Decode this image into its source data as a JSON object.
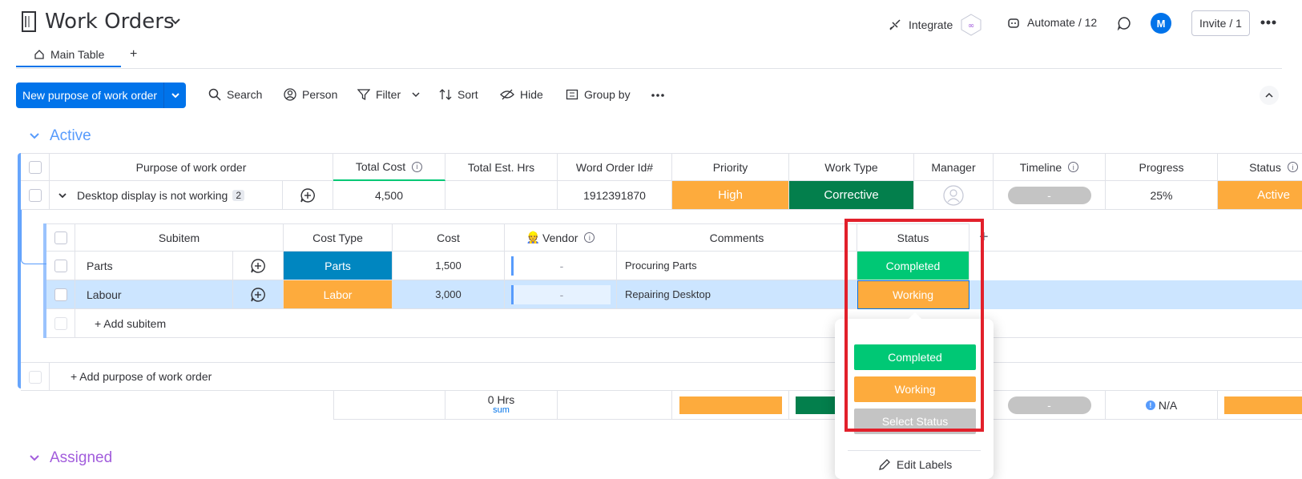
{
  "board": {
    "title": "Work Orders",
    "actions": {
      "integrate": "Integrate",
      "automate": "Automate / 12",
      "avatar_initial": "M",
      "invite": "Invite / 1"
    }
  },
  "tabs": [
    {
      "label": "Main Table"
    },
    {
      "label": "+"
    }
  ],
  "toolbar": {
    "new_item": "New purpose of work order",
    "search": "Search",
    "person": "Person",
    "filter": "Filter",
    "sort": "Sort",
    "hide": "Hide",
    "group_by": "Group by"
  },
  "groups": {
    "active": {
      "title": "Active",
      "color": "#579bfc"
    },
    "assigned": {
      "title": "Assigned",
      "color": "#a25ddc"
    }
  },
  "columns": {
    "purpose": "Purpose of work order",
    "total_cost": "Total Cost",
    "total_est_hrs": "Total Est. Hrs",
    "order_id": "Word Order Id#",
    "priority": "Priority",
    "work_type": "Work Type",
    "manager": "Manager",
    "timeline": "Timeline",
    "progress": "Progress",
    "status": "Status"
  },
  "row": {
    "name": "Desktop display is not working",
    "subitem_count": "2",
    "total_cost": "4,500",
    "order_id": "1912391870",
    "priority": "High",
    "work_type": "Corrective",
    "timeline": "-",
    "progress": "25%",
    "status": "Active"
  },
  "subitems": {
    "columns": {
      "subitem": "Subitem",
      "cost_type": "Cost Type",
      "cost": "Cost",
      "vendor": "Vendor",
      "comments": "Comments",
      "status": "Status",
      "add": "+"
    },
    "rows": [
      {
        "name": "Parts",
        "cost_type": "Parts",
        "cost": "1,500",
        "vendor": "-",
        "comments": "Procuring Parts",
        "status": "Completed"
      },
      {
        "name": "Labour",
        "cost_type": "Labor",
        "cost": "3,000",
        "vendor": "-",
        "comments": "Repairing Desktop",
        "status": "Working"
      }
    ],
    "add_label": "+ Add subitem"
  },
  "add_item_label": "+ Add purpose of work order",
  "summary": {
    "est_hrs": "0 Hrs",
    "est_hrs_fn": "sum",
    "timeline": "-",
    "progress": "N/A"
  },
  "status_menu": {
    "options": [
      "Completed",
      "Working",
      "Select Status"
    ],
    "edit_labels": "Edit Labels"
  },
  "colors": {
    "primary": "#0073ea",
    "high": "#fdab3d",
    "corrective": "#037f4c",
    "completed": "#00c875",
    "working": "#fdab3d",
    "default": "#c4c4c4",
    "parts": "#0086c0",
    "highlight": "#cce5ff"
  }
}
